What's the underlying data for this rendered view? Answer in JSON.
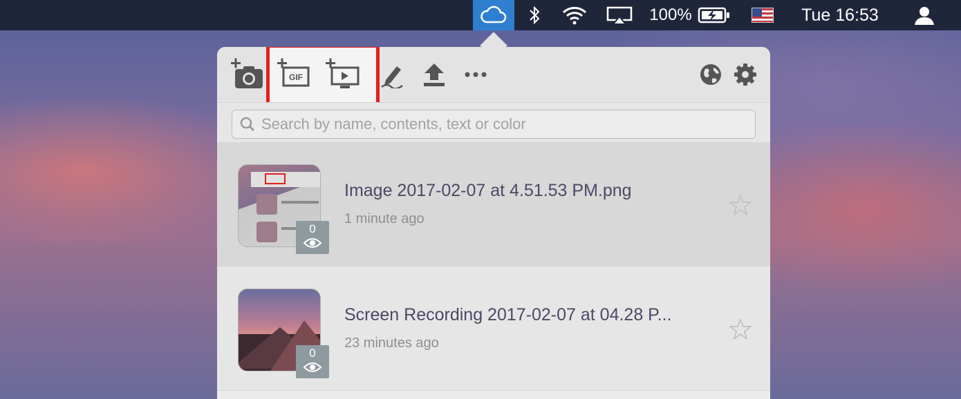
{
  "menubar": {
    "cloud_icon": "cloud-icon",
    "bluetooth_icon": "bluetooth-icon",
    "wifi_icon": "wifi-icon",
    "airplay_icon": "airplay-icon",
    "battery_percent": "100%",
    "battery_icon": "battery-charging-icon",
    "flag_icon": "us-flag-icon",
    "clock": "Tue 16:53",
    "user_icon": "user-icon",
    "cloud_highlight_color": "#2f7fd0"
  },
  "toolbar": {
    "buttons": [
      {
        "name": "screenshot",
        "icon": "camera-plus-icon"
      },
      {
        "name": "gif",
        "icon": "gif-record-icon",
        "label": "GIF"
      },
      {
        "name": "screen-recording",
        "icon": "screen-record-icon"
      },
      {
        "name": "annotate",
        "icon": "pen-icon"
      },
      {
        "name": "upload",
        "icon": "upload-icon"
      },
      {
        "name": "more",
        "icon": "more-icon"
      },
      {
        "name": "web",
        "icon": "globe-icon"
      },
      {
        "name": "settings",
        "icon": "gear-icon"
      }
    ],
    "highlight_color": "#e3201c"
  },
  "search": {
    "placeholder": "Search by name, contents, text or color"
  },
  "items": [
    {
      "title": "Image 2017-02-07 at 4.51.53 PM.png",
      "time": "1 minute ago",
      "views": "0"
    },
    {
      "title": "Screen Recording 2017-02-07 at 04.28 P...",
      "time": "23 minutes ago",
      "views": "0"
    }
  ]
}
